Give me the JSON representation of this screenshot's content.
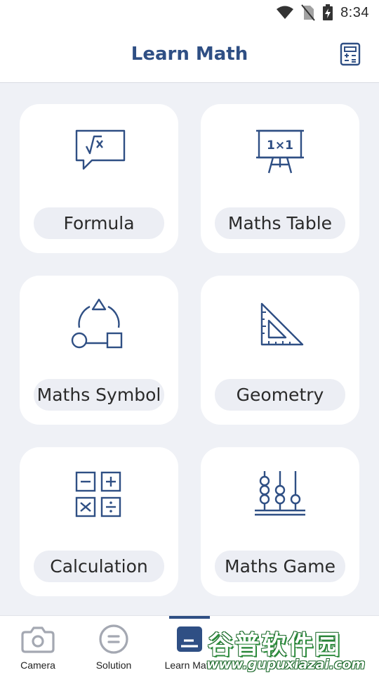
{
  "status_bar": {
    "time": "8:34",
    "icons": [
      "wifi-icon",
      "no-sim-icon",
      "battery-charging-icon"
    ]
  },
  "app_bar": {
    "title": "Learn Math",
    "action_icon": "calculator-icon"
  },
  "cards": [
    {
      "label": "Formula",
      "icon": "formula-icon"
    },
    {
      "label": "Maths Table",
      "icon": "maths-table-icon"
    },
    {
      "label": "Maths Symbol",
      "icon": "maths-symbol-icon"
    },
    {
      "label": "Geometry",
      "icon": "geometry-icon"
    },
    {
      "label": "Calculation",
      "icon": "calculation-icon"
    },
    {
      "label": "Maths Game",
      "icon": "maths-game-icon"
    }
  ],
  "bottom_nav": {
    "active": "Learn Math",
    "items": [
      {
        "label": "Camera",
        "icon": "camera-icon"
      },
      {
        "label": "Solution",
        "icon": "solution-icon"
      },
      {
        "label": "Learn Math",
        "icon": "learn-math-icon"
      }
    ]
  },
  "watermark": {
    "logo_text": "谷普软件园",
    "url": "www.gupuxiazai.com"
  },
  "colors": {
    "accent": "#2f4f84",
    "background": "#eff1f6",
    "card": "#ffffff",
    "pill": "#eceef4"
  }
}
